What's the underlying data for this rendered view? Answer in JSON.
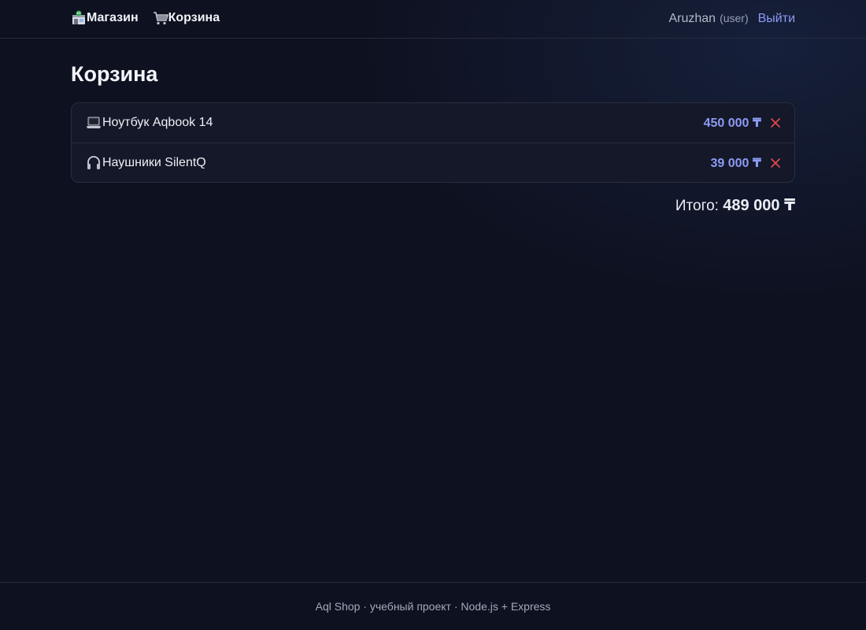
{
  "nav": {
    "shop_label": "Магазин",
    "shop_icon": "shop-icon",
    "cart_label": "Корзина",
    "cart_icon": "cart-icon",
    "username": "Aruzhan",
    "role": "(user)",
    "logout_label": "Выйти"
  },
  "page": {
    "title": "Корзина"
  },
  "cart": {
    "items": [
      {
        "icon": "laptop-icon",
        "name": "Ноутбук Aqbook 14",
        "price": "450 000 ₸"
      },
      {
        "icon": "headphones-icon",
        "name": "Наушники SilentQ",
        "price": "39 000 ₸"
      }
    ],
    "total_label": "Итого:",
    "total_value": "489 000 ₸"
  },
  "footer": {
    "text": "Aql Shop · учебный проект · Node.js + Express"
  },
  "colors": {
    "background": "#0e1120",
    "accent": "#8d9bf5",
    "remove": "#e5484d"
  }
}
